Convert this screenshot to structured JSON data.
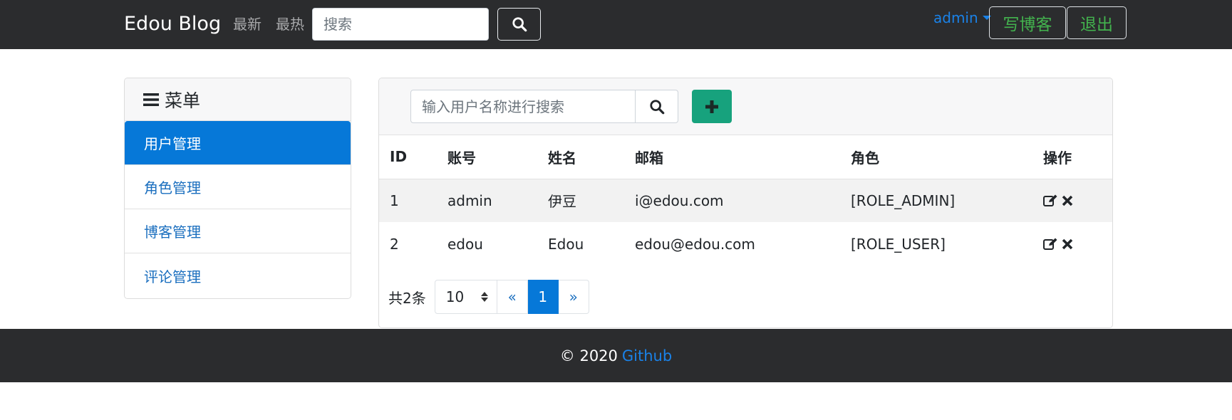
{
  "navbar": {
    "brand": "Edou Blog",
    "links": [
      "最新",
      "最热"
    ],
    "search_placeholder": "搜索",
    "user": "admin",
    "write_label": "写博客",
    "logout_label": "退出"
  },
  "sidebar": {
    "title": "菜单",
    "items": [
      {
        "label": "用户管理",
        "active": true
      },
      {
        "label": "角色管理",
        "active": false
      },
      {
        "label": "博客管理",
        "active": false
      },
      {
        "label": "评论管理",
        "active": false
      }
    ]
  },
  "main": {
    "search_placeholder": "输入用户名称进行搜索",
    "table": {
      "headers": [
        "ID",
        "账号",
        "姓名",
        "邮箱",
        "角色",
        "操作"
      ],
      "rows": [
        {
          "id": "1",
          "account": "admin",
          "name": "伊豆",
          "email": "i@edou.com",
          "role": "[ROLE_ADMIN]"
        },
        {
          "id": "2",
          "account": "edou",
          "name": "Edou",
          "email": "edou@edou.com",
          "role": "[ROLE_USER]"
        }
      ]
    },
    "pager": {
      "total": "共2条",
      "page_size": "10",
      "prev": "«",
      "current": "1",
      "next": "»"
    }
  },
  "footer": {
    "copyright": "© 2020",
    "link": "Github"
  },
  "colors": {
    "navbar_bg": "#2b2c2e",
    "accent": "#0678d8",
    "link": "#1a82e8",
    "success": "#43b34e",
    "add_button": "#17a27d"
  }
}
